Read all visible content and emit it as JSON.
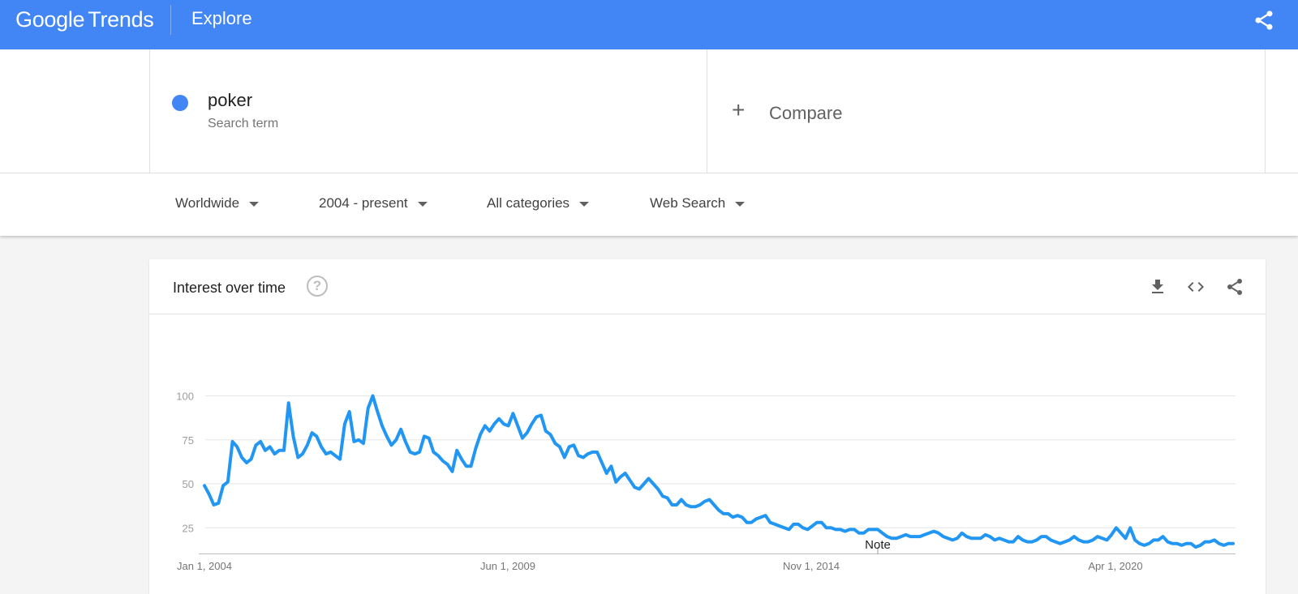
{
  "header": {
    "logo_google": "Google",
    "logo_trends": "Trends",
    "page_title": "Explore",
    "share_icon": "share-icon",
    "bar_color": "#4285f4"
  },
  "search": {
    "term": "poker",
    "term_type": "Search term",
    "term_color": "#4285f4",
    "compare_icon": "plus-icon",
    "compare_label": "Compare"
  },
  "filters": [
    {
      "label": "Worldwide"
    },
    {
      "label": "2004 - present"
    },
    {
      "label": "All categories"
    },
    {
      "label": "Web Search"
    }
  ],
  "card": {
    "title": "Interest over time",
    "help_icon": "help-icon",
    "help_glyph": "?",
    "actions": [
      "download-icon",
      "embed-icon",
      "share-icon"
    ]
  },
  "chart_data": {
    "type": "line",
    "title": "",
    "xlabel": "",
    "ylabel": "",
    "ylim": [
      0,
      100
    ],
    "y_ticks": [
      "25",
      "50",
      "75",
      "100"
    ],
    "x_ticks": [
      "Jan 1, 2004",
      "Jun 1, 2009",
      "Nov 1, 2014",
      "Apr 1, 2020"
    ],
    "annotation": "Note",
    "line_color": "#2196f3",
    "grid": true,
    "series": [
      {
        "values": [
          49,
          44,
          38,
          39,
          49,
          51,
          74,
          71,
          65,
          62,
          64,
          72,
          74,
          69,
          71,
          67,
          69,
          69,
          96,
          77,
          65,
          67,
          72,
          79,
          77,
          71,
          67,
          68,
          66,
          64,
          84,
          91,
          74,
          75,
          73,
          93,
          100,
          91,
          83,
          77,
          72,
          75,
          81,
          74,
          68,
          67,
          68,
          77,
          76,
          68,
          66,
          63,
          61,
          57,
          69,
          64,
          60,
          60,
          70,
          78,
          83,
          80,
          84,
          87,
          84,
          83,
          90,
          83,
          76,
          79,
          84,
          88,
          89,
          80,
          78,
          73,
          71,
          65,
          71,
          72,
          66,
          65,
          67,
          68,
          68,
          62,
          56,
          60,
          51,
          54,
          56,
          52,
          48,
          47,
          50,
          53,
          50,
          47,
          43,
          42,
          38,
          38,
          41,
          38,
          37,
          37,
          38,
          40,
          41,
          38,
          35,
          33,
          33,
          31,
          32,
          31,
          28,
          28,
          30,
          31,
          32,
          28,
          27,
          26,
          25,
          24,
          27,
          27,
          25,
          24,
          26,
          28,
          28,
          25,
          25,
          24,
          24,
          23,
          24,
          24,
          22,
          22,
          24,
          24,
          24,
          22,
          20,
          19,
          19,
          20,
          21,
          20,
          20,
          20,
          21,
          22,
          23,
          22,
          20,
          19,
          18,
          19,
          22,
          20,
          19,
          19,
          19,
          21,
          20,
          18,
          19,
          18,
          17,
          17,
          20,
          18,
          17,
          17,
          18,
          20,
          20,
          18,
          17,
          16,
          17,
          18,
          20,
          18,
          17,
          17,
          18,
          20,
          19,
          18,
          21,
          25,
          22,
          19,
          25,
          18,
          16,
          15,
          16,
          18,
          18,
          20,
          17,
          16,
          16,
          15,
          16,
          16,
          14,
          15,
          17,
          17,
          18,
          16,
          15,
          16,
          16
        ]
      }
    ]
  }
}
